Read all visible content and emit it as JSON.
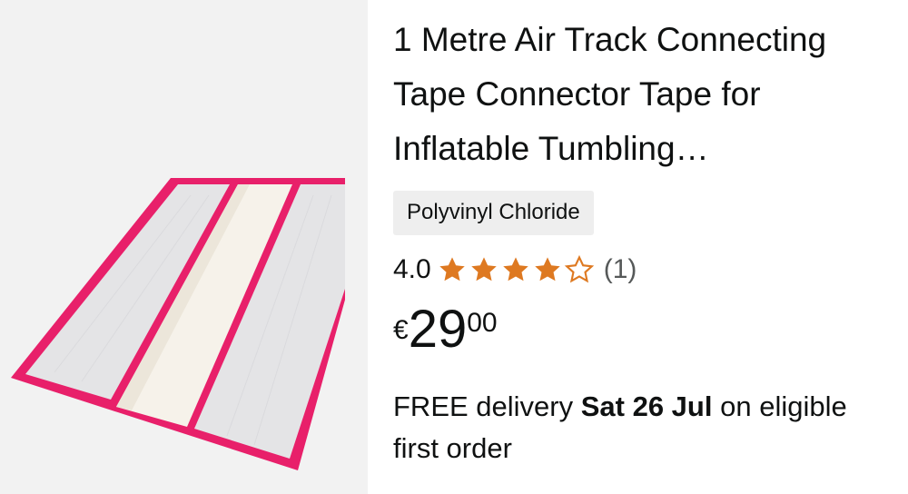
{
  "product": {
    "title": "1 Metre Air Track Connecting Tape Connector Tape for Inflatable Tumbling…",
    "material": "Polyvinyl Chloride",
    "rating": {
      "value": "4.0",
      "stars": 4,
      "max_stars": 5,
      "count": "(1)"
    },
    "price": {
      "currency": "€",
      "whole": "29",
      "fraction": "00"
    },
    "delivery": {
      "prefix": "FREE delivery",
      "date": "Sat 26 Jul",
      "suffix": "on eligible first order"
    },
    "image_icon": "product-photo-connector-tape"
  },
  "colors": {
    "star": "#de7921",
    "tape_border": "#e8206a",
    "tape_fill": "#e6e6e6",
    "badge_bg": "#eeeeee",
    "image_bg": "#f2f2f2"
  }
}
